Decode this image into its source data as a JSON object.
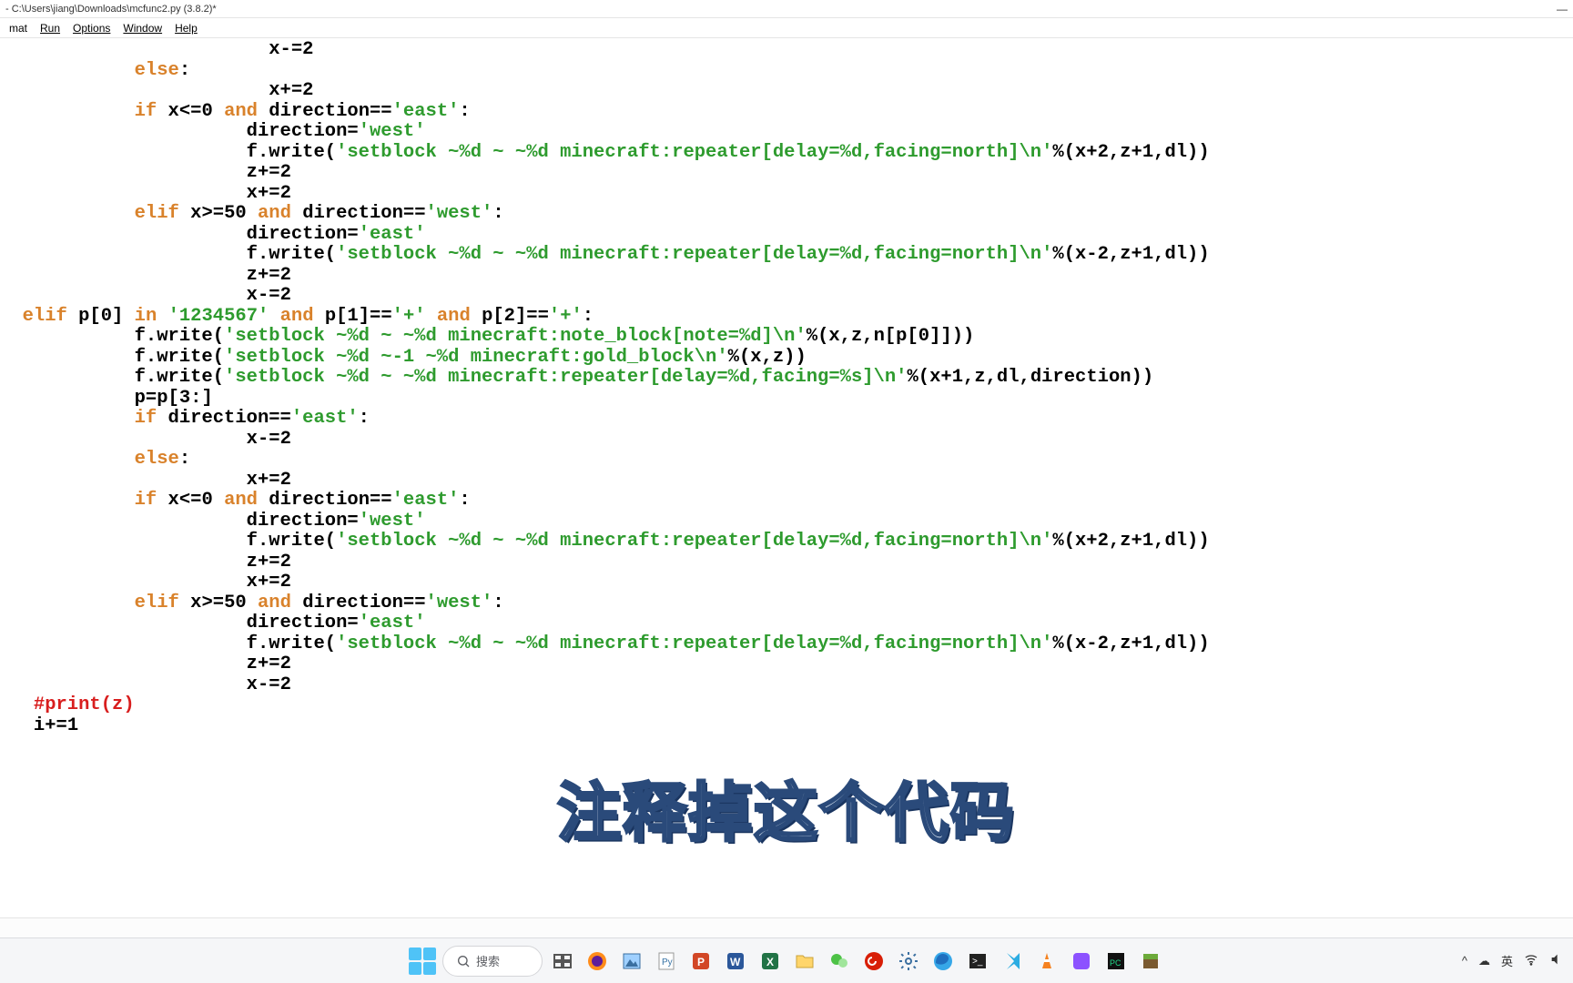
{
  "window": {
    "title": "- C:\\Users\\jiang\\Downloads\\mcfunc2.py (3.8.2)*"
  },
  "menus": {
    "format": "mat",
    "run": "Run",
    "options": "Options",
    "window": "Window",
    "help": "Help"
  },
  "code": {
    "lines": [
      {
        "indent": 24,
        "tokens": [
          {
            "c": "plain",
            "t": "x-="
          },
          {
            "c": "num",
            "t": "2"
          }
        ]
      },
      {
        "indent": 12,
        "tokens": [
          {
            "c": "kw",
            "t": "else"
          },
          {
            "c": "plain",
            "t": ":"
          }
        ]
      },
      {
        "indent": 24,
        "tokens": [
          {
            "c": "plain",
            "t": "x+="
          },
          {
            "c": "num",
            "t": "2"
          }
        ]
      },
      {
        "indent": 12,
        "tokens": [
          {
            "c": "kw",
            "t": "if"
          },
          {
            "c": "plain",
            "t": " x<="
          },
          {
            "c": "num",
            "t": "0"
          },
          {
            "c": "plain",
            "t": " "
          },
          {
            "c": "kw",
            "t": "and"
          },
          {
            "c": "plain",
            "t": " direction=="
          },
          {
            "c": "str",
            "t": "'east'"
          },
          {
            "c": "plain",
            "t": ":"
          }
        ]
      },
      {
        "indent": 22,
        "tokens": [
          {
            "c": "plain",
            "t": "direction="
          },
          {
            "c": "str",
            "t": "'west'"
          }
        ]
      },
      {
        "indent": 22,
        "tokens": [
          {
            "c": "plain",
            "t": "f.write("
          },
          {
            "c": "str",
            "t": "'setblock ~%d ~ ~%d minecraft:repeater[delay=%d,facing=north]\\n'"
          },
          {
            "c": "plain",
            "t": "%(x+"
          },
          {
            "c": "num",
            "t": "2"
          },
          {
            "c": "plain",
            "t": ",z+"
          },
          {
            "c": "num",
            "t": "1"
          },
          {
            "c": "plain",
            "t": ",dl))"
          }
        ]
      },
      {
        "indent": 22,
        "tokens": [
          {
            "c": "plain",
            "t": "z+="
          },
          {
            "c": "num",
            "t": "2"
          }
        ]
      },
      {
        "indent": 22,
        "tokens": [
          {
            "c": "plain",
            "t": "x+="
          },
          {
            "c": "num",
            "t": "2"
          }
        ]
      },
      {
        "indent": 12,
        "tokens": [
          {
            "c": "kw",
            "t": "elif"
          },
          {
            "c": "plain",
            "t": " x>="
          },
          {
            "c": "num",
            "t": "50"
          },
          {
            "c": "plain",
            "t": " "
          },
          {
            "c": "kw",
            "t": "and"
          },
          {
            "c": "plain",
            "t": " direction=="
          },
          {
            "c": "str",
            "t": "'west'"
          },
          {
            "c": "plain",
            "t": ":"
          }
        ]
      },
      {
        "indent": 22,
        "tokens": [
          {
            "c": "plain",
            "t": "direction="
          },
          {
            "c": "str",
            "t": "'east'"
          }
        ]
      },
      {
        "indent": 22,
        "tokens": [
          {
            "c": "plain",
            "t": "f.write("
          },
          {
            "c": "str",
            "t": "'setblock ~%d ~ ~%d minecraft:repeater[delay=%d,facing=north]\\n'"
          },
          {
            "c": "plain",
            "t": "%(x-"
          },
          {
            "c": "num",
            "t": "2"
          },
          {
            "c": "plain",
            "t": ",z+"
          },
          {
            "c": "num",
            "t": "1"
          },
          {
            "c": "plain",
            "t": ",dl))"
          }
        ]
      },
      {
        "indent": 22,
        "tokens": [
          {
            "c": "plain",
            "t": "z+="
          },
          {
            "c": "num",
            "t": "2"
          }
        ]
      },
      {
        "indent": 22,
        "tokens": [
          {
            "c": "plain",
            "t": "x-="
          },
          {
            "c": "num",
            "t": "2"
          }
        ]
      },
      {
        "indent": 2,
        "tokens": [
          {
            "c": "kw",
            "t": "elif"
          },
          {
            "c": "plain",
            "t": " p["
          },
          {
            "c": "num",
            "t": "0"
          },
          {
            "c": "plain",
            "t": "] "
          },
          {
            "c": "kw",
            "t": "in"
          },
          {
            "c": "plain",
            "t": " "
          },
          {
            "c": "str",
            "t": "'1234567'"
          },
          {
            "c": "plain",
            "t": " "
          },
          {
            "c": "kw",
            "t": "and"
          },
          {
            "c": "plain",
            "t": " p["
          },
          {
            "c": "num",
            "t": "1"
          },
          {
            "c": "plain",
            "t": "]=="
          },
          {
            "c": "str",
            "t": "'+'"
          },
          {
            "c": "plain",
            "t": " "
          },
          {
            "c": "kw",
            "t": "and"
          },
          {
            "c": "plain",
            "t": " p["
          },
          {
            "c": "num",
            "t": "2"
          },
          {
            "c": "plain",
            "t": "]=="
          },
          {
            "c": "str",
            "t": "'+'"
          },
          {
            "c": "plain",
            "t": ":"
          }
        ]
      },
      {
        "indent": 12,
        "tokens": [
          {
            "c": "plain",
            "t": "f.write("
          },
          {
            "c": "str",
            "t": "'setblock ~%d ~ ~%d minecraft:note_block[note=%d]\\n'"
          },
          {
            "c": "plain",
            "t": "%(x,z,n[p["
          },
          {
            "c": "num",
            "t": "0"
          },
          {
            "c": "plain",
            "t": "]]))"
          }
        ]
      },
      {
        "indent": 12,
        "tokens": [
          {
            "c": "plain",
            "t": "f.write("
          },
          {
            "c": "str",
            "t": "'setblock ~%d ~-1 ~%d minecraft:gold_block\\n'"
          },
          {
            "c": "plain",
            "t": "%(x,z))"
          }
        ]
      },
      {
        "indent": 12,
        "tokens": [
          {
            "c": "plain",
            "t": "f.write("
          },
          {
            "c": "str",
            "t": "'setblock ~%d ~ ~%d minecraft:repeater[delay=%d,facing=%s]\\n'"
          },
          {
            "c": "plain",
            "t": "%(x+"
          },
          {
            "c": "num",
            "t": "1"
          },
          {
            "c": "plain",
            "t": ",z,dl,direction))"
          }
        ]
      },
      {
        "indent": 12,
        "tokens": [
          {
            "c": "plain",
            "t": "p=p["
          },
          {
            "c": "num",
            "t": "3"
          },
          {
            "c": "plain",
            "t": ":]"
          }
        ]
      },
      {
        "indent": 12,
        "tokens": [
          {
            "c": "kw",
            "t": "if"
          },
          {
            "c": "plain",
            "t": " direction=="
          },
          {
            "c": "str",
            "t": "'east'"
          },
          {
            "c": "plain",
            "t": ":"
          }
        ]
      },
      {
        "indent": 22,
        "tokens": [
          {
            "c": "plain",
            "t": "x-="
          },
          {
            "c": "num",
            "t": "2"
          }
        ]
      },
      {
        "indent": 12,
        "tokens": [
          {
            "c": "kw",
            "t": "else"
          },
          {
            "c": "plain",
            "t": ":"
          }
        ]
      },
      {
        "indent": 22,
        "tokens": [
          {
            "c": "plain",
            "t": "x+="
          },
          {
            "c": "num",
            "t": "2"
          }
        ]
      },
      {
        "indent": 12,
        "tokens": [
          {
            "c": "kw",
            "t": "if"
          },
          {
            "c": "plain",
            "t": " x<="
          },
          {
            "c": "num",
            "t": "0"
          },
          {
            "c": "plain",
            "t": " "
          },
          {
            "c": "kw",
            "t": "and"
          },
          {
            "c": "plain",
            "t": " direction=="
          },
          {
            "c": "str",
            "t": "'east'"
          },
          {
            "c": "plain",
            "t": ":"
          }
        ]
      },
      {
        "indent": 22,
        "tokens": [
          {
            "c": "plain",
            "t": "direction="
          },
          {
            "c": "str",
            "t": "'west'"
          }
        ]
      },
      {
        "indent": 22,
        "tokens": [
          {
            "c": "plain",
            "t": "f.write("
          },
          {
            "c": "str",
            "t": "'setblock ~%d ~ ~%d minecraft:repeater[delay=%d,facing=north]\\n'"
          },
          {
            "c": "plain",
            "t": "%(x+"
          },
          {
            "c": "num",
            "t": "2"
          },
          {
            "c": "plain",
            "t": ",z+"
          },
          {
            "c": "num",
            "t": "1"
          },
          {
            "c": "plain",
            "t": ",dl))"
          }
        ]
      },
      {
        "indent": 22,
        "tokens": [
          {
            "c": "plain",
            "t": "z+="
          },
          {
            "c": "num",
            "t": "2"
          }
        ]
      },
      {
        "indent": 22,
        "tokens": [
          {
            "c": "plain",
            "t": "x+="
          },
          {
            "c": "num",
            "t": "2"
          }
        ]
      },
      {
        "indent": 12,
        "tokens": [
          {
            "c": "kw",
            "t": "elif"
          },
          {
            "c": "plain",
            "t": " x>="
          },
          {
            "c": "num",
            "t": "50"
          },
          {
            "c": "plain",
            "t": " "
          },
          {
            "c": "kw",
            "t": "and"
          },
          {
            "c": "plain",
            "t": " direction=="
          },
          {
            "c": "str",
            "t": "'west'"
          },
          {
            "c": "plain",
            "t": ":"
          }
        ]
      },
      {
        "indent": 22,
        "tokens": [
          {
            "c": "plain",
            "t": "direction="
          },
          {
            "c": "str",
            "t": "'east'"
          }
        ]
      },
      {
        "indent": 22,
        "tokens": [
          {
            "c": "plain",
            "t": "f.write("
          },
          {
            "c": "str",
            "t": "'setblock ~%d ~ ~%d minecraft:repeater[delay=%d,facing=north]\\n'"
          },
          {
            "c": "plain",
            "t": "%(x-"
          },
          {
            "c": "num",
            "t": "2"
          },
          {
            "c": "plain",
            "t": ",z+"
          },
          {
            "c": "num",
            "t": "1"
          },
          {
            "c": "plain",
            "t": ",dl))"
          }
        ]
      },
      {
        "indent": 22,
        "tokens": [
          {
            "c": "plain",
            "t": "z+="
          },
          {
            "c": "num",
            "t": "2"
          }
        ]
      },
      {
        "indent": 22,
        "tokens": [
          {
            "c": "plain",
            "t": "x-="
          },
          {
            "c": "num",
            "t": "2"
          }
        ]
      },
      {
        "indent": 3,
        "tokens": [
          {
            "c": "comment",
            "t": "#print(z)"
          }
        ]
      },
      {
        "indent": 3,
        "tokens": [
          {
            "c": "plain",
            "t": "i+="
          },
          {
            "c": "num",
            "t": "1"
          }
        ]
      }
    ]
  },
  "overlay": {
    "caption": "注释掉这个代码"
  },
  "taskbar": {
    "search_placeholder": "搜索",
    "ime": "英"
  }
}
